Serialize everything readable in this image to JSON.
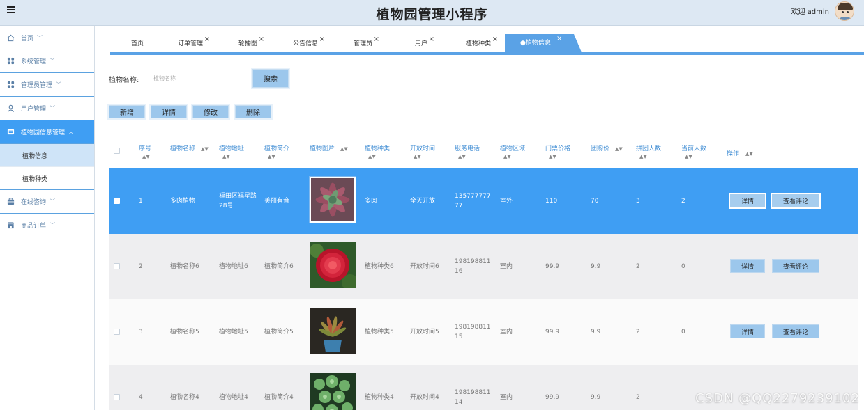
{
  "header": {
    "title": "植物园管理小程序",
    "welcome": "欢迎 admin"
  },
  "sidebar": {
    "items": [
      {
        "label": "首页",
        "icon": "home-icon"
      },
      {
        "label": "系统管理",
        "icon": "grid-icon"
      },
      {
        "label": "管理员管理",
        "icon": "grid-icon"
      },
      {
        "label": "用户管理",
        "icon": "user-icon"
      },
      {
        "label": "植物园信息管理",
        "icon": "card-icon",
        "active": true
      },
      {
        "label": "在线咨询",
        "icon": "box-icon"
      },
      {
        "label": "商品订单",
        "icon": "shop-icon"
      }
    ],
    "sub": [
      {
        "label": "植物信息"
      },
      {
        "label": "植物种类"
      }
    ],
    "chevron": "﹀"
  },
  "tabs": [
    {
      "label": "首页"
    },
    {
      "label": "订单管理"
    },
    {
      "label": "轮播图"
    },
    {
      "label": "公告信息"
    },
    {
      "label": "管理员"
    },
    {
      "label": "用户"
    },
    {
      "label": "植物种类"
    },
    {
      "label": "●植物信息"
    }
  ],
  "tab_close": "×",
  "search": {
    "label": "植物名称:",
    "placeholder": "植物名称",
    "button": "搜索"
  },
  "actions": {
    "add": "新增",
    "detail": "详情",
    "edit": "修改",
    "delete": "删除"
  },
  "table": {
    "columns": [
      "序号",
      "植物名称",
      "植物地址",
      "植物简介",
      "植物图片",
      "植物种类",
      "开放时间",
      "服务电话",
      "植物区域",
      "门票价格",
      "团购价",
      "拼团人数",
      "当前人数",
      "操作"
    ],
    "sort_glyph": "▲▼",
    "row_buttons": {
      "detail": "详情",
      "comments": "查看评论"
    },
    "rows": [
      {
        "no": "1",
        "name": "多肉植物",
        "addr": "福田区福星路28号",
        "intro": "美丽有音",
        "kind": "多肉",
        "open": "全天开放",
        "phone": "13577777777",
        "area": "室外",
        "price": "110",
        "group": "70",
        "group_num": "3",
        "cur_num": "2"
      },
      {
        "no": "2",
        "name": "植物名称6",
        "addr": "植物地址6",
        "intro": "植物简介6",
        "kind": "植物种类6",
        "open": "开放时间6",
        "phone": "19819881116",
        "area": "室内",
        "price": "99.9",
        "group": "9.9",
        "group_num": "2",
        "cur_num": "0"
      },
      {
        "no": "3",
        "name": "植物名称5",
        "addr": "植物地址5",
        "intro": "植物简介5",
        "kind": "植物种类5",
        "open": "开放时间5",
        "phone": "19819881115",
        "area": "室内",
        "price": "99.9",
        "group": "9.9",
        "group_num": "2",
        "cur_num": "0"
      },
      {
        "no": "4",
        "name": "植物名称4",
        "addr": "植物地址4",
        "intro": "植物简介4",
        "kind": "植物种类4",
        "open": "开放时间4",
        "phone": "19819881114",
        "area": "室内",
        "price": "99.9",
        "group": "9.9",
        "group_num": "2",
        "cur_num": ""
      }
    ]
  },
  "watermark": "CSDN @QQ2279239102",
  "colors": {
    "accent": "#3f9ef3",
    "header_bg": "#dde8f3",
    "button": "#9cc7ec"
  }
}
